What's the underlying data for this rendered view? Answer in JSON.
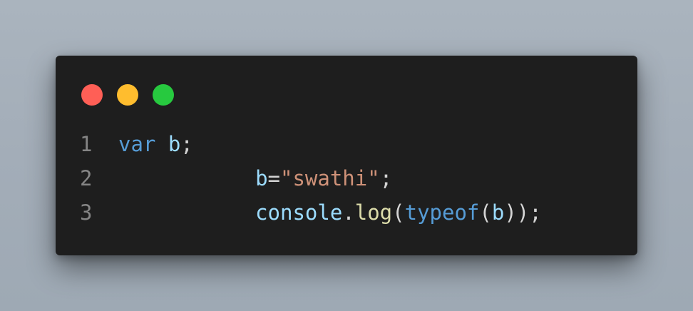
{
  "window": {
    "controls": {
      "close_color": "#ff5f56",
      "minimize_color": "#ffbd2e",
      "maximize_color": "#27c93f"
    }
  },
  "code": {
    "lines": [
      {
        "number": "1",
        "tokens": [
          {
            "text": "var",
            "type": "kw"
          },
          {
            "text": " ",
            "type": "ws"
          },
          {
            "text": "b",
            "type": "var"
          },
          {
            "text": ";",
            "type": "punct"
          }
        ]
      },
      {
        "number": "2",
        "tokens": [
          {
            "text": "           ",
            "type": "ws"
          },
          {
            "text": "b",
            "type": "var"
          },
          {
            "text": "=",
            "type": "punct"
          },
          {
            "text": "\"swathi\"",
            "type": "str"
          },
          {
            "text": ";",
            "type": "punct"
          }
        ]
      },
      {
        "number": "3",
        "tokens": [
          {
            "text": "           ",
            "type": "ws"
          },
          {
            "text": "console",
            "type": "var"
          },
          {
            "text": ".",
            "type": "punct"
          },
          {
            "text": "log",
            "type": "fn"
          },
          {
            "text": "(",
            "type": "punct"
          },
          {
            "text": "typeof",
            "type": "kw"
          },
          {
            "text": "(",
            "type": "punct"
          },
          {
            "text": "b",
            "type": "var"
          },
          {
            "text": "));",
            "type": "punct"
          }
        ]
      }
    ]
  }
}
